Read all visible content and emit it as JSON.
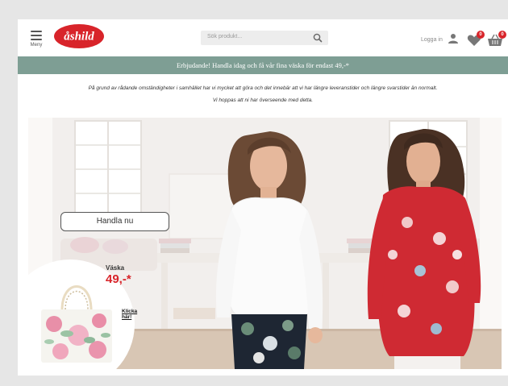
{
  "header": {
    "menu_label": "Meny",
    "logo_text": "åshild",
    "search_placeholder": "Sök produkt...",
    "login_label": "Logga in",
    "wishlist_count": "0",
    "cart_count": "0"
  },
  "offer_bar": {
    "text": "Erbjudande! Handla idag och få vår fina väska för endast 49,-*"
  },
  "notice": {
    "line1": "På grund av rådande omständigheter i samhället har vi mycket att göra  och det innebär att vi har längre leveranstider och längre svarstider än normalt.",
    "line2": "Vi hoppas att ni har överseende med detta."
  },
  "hero": {
    "shop_button": "Handla nu",
    "promo": {
      "product_name": "Väska",
      "price": "49,-*",
      "cta": "Klicka här!"
    }
  },
  "colors": {
    "brand_red": "#d8242a",
    "offer_bar": "#7e9e94"
  }
}
